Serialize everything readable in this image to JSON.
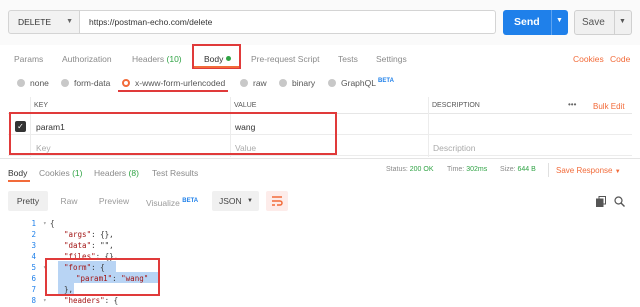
{
  "request": {
    "method": "DELETE",
    "url": "https://postman-echo.com/delete",
    "send_label": "Send",
    "save_label": "Save"
  },
  "request_tabs": {
    "params": "Params",
    "authorization": "Authorization",
    "headers_label": "Headers",
    "headers_count": "(10)",
    "body": "Body",
    "prerequest": "Pre-request Script",
    "tests": "Tests",
    "settings": "Settings",
    "cookies": "Cookies",
    "code": "Code"
  },
  "body_types": {
    "none": "none",
    "form_data": "form-data",
    "urlencoded": "x-www-form-urlencoded",
    "raw": "raw",
    "binary": "binary",
    "graphql": "GraphQL",
    "beta": "BETA",
    "selected": "x-www-form-urlencoded"
  },
  "params_table": {
    "headers": {
      "key": "KEY",
      "value": "VALUE",
      "description": "DESCRIPTION",
      "more": "•••",
      "bulk_edit": "Bulk Edit"
    },
    "rows": [
      {
        "checked": true,
        "key": "param1",
        "value": "wang",
        "description": ""
      }
    ],
    "placeholder": {
      "key": "Key",
      "value": "Value",
      "description": "Description"
    }
  },
  "response_tabs": {
    "body": "Body",
    "cookies_label": "Cookies",
    "cookies_count": "(1)",
    "headers_label": "Headers",
    "headers_count": "(8)",
    "test_results": "Test Results"
  },
  "response_status": {
    "status_label": "Status:",
    "status_value": "200 OK",
    "time_label": "Time:",
    "time_value": "302ms",
    "size_label": "Size:",
    "size_value": "644 B",
    "save_response": "Save Response"
  },
  "viewer": {
    "pretty": "Pretty",
    "raw": "Raw",
    "preview": "Preview",
    "visualize": "Visualize",
    "beta": "BETA",
    "format": "JSON"
  },
  "code_lines": [
    {
      "n": "1",
      "text": "{"
    },
    {
      "n": "2",
      "key": "\"args\"",
      "rest": ": {},"
    },
    {
      "n": "3",
      "key": "\"data\"",
      "rest": ": \"\","
    },
    {
      "n": "4",
      "key": "\"files\"",
      "rest": ": {},"
    },
    {
      "n": "5",
      "key": "\"form\"",
      "rest": ": {"
    },
    {
      "n": "6",
      "key": "\"param1\"",
      "rest": ": ",
      "str": "\"wang\""
    },
    {
      "n": "7",
      "text": "},"
    },
    {
      "n": "8",
      "key": "\"headers\"",
      "rest": ": {"
    }
  ],
  "colors": {
    "accent": "#f26b3a",
    "send": "#1f80ea",
    "highlight_box": "#e03a3a",
    "success": "#2fa344"
  }
}
